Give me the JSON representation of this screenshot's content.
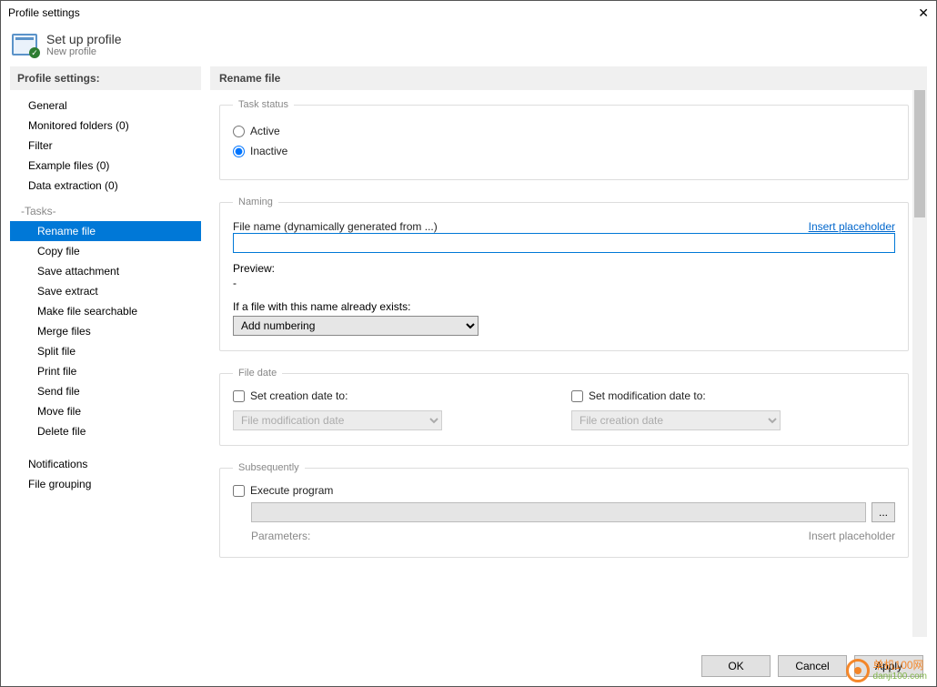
{
  "window": {
    "title": "Profile settings"
  },
  "header": {
    "title": "Set up profile",
    "subtitle": "New profile"
  },
  "sidebar": {
    "heading": "Profile settings:",
    "items": [
      {
        "label": "General",
        "indent": false
      },
      {
        "label": "Monitored folders (0)",
        "indent": false
      },
      {
        "label": "Filter",
        "indent": false
      },
      {
        "label": "Example files (0)",
        "indent": false
      },
      {
        "label": "Data extraction (0)",
        "indent": false
      },
      {
        "label": "-Tasks-",
        "separator": true
      },
      {
        "label": "Rename file",
        "indent": true,
        "selected": true
      },
      {
        "label": "Copy file",
        "indent": true
      },
      {
        "label": "Save attachment",
        "indent": true
      },
      {
        "label": "Save extract",
        "indent": true
      },
      {
        "label": "Make file searchable",
        "indent": true
      },
      {
        "label": "Merge files",
        "indent": true
      },
      {
        "label": "Split file",
        "indent": true
      },
      {
        "label": "Print file",
        "indent": true
      },
      {
        "label": "Send file",
        "indent": true
      },
      {
        "label": "Move file",
        "indent": true
      },
      {
        "label": "Delete file",
        "indent": true
      },
      {
        "label": "",
        "separator": true
      },
      {
        "label": "Notifications",
        "indent": false
      },
      {
        "label": "File grouping",
        "indent": false
      }
    ]
  },
  "content": {
    "heading": "Rename file",
    "task_status": {
      "legend": "Task status",
      "active_label": "Active",
      "inactive_label": "Inactive",
      "selected": "inactive"
    },
    "naming": {
      "legend": "Naming",
      "filename_label": "File name (dynamically generated from ...)",
      "insert_placeholder": "Insert placeholder",
      "filename_value": "",
      "preview_label": "Preview:",
      "preview_value": "-",
      "exists_label": "If a file with this name already exists:",
      "exists_value": "Add numbering"
    },
    "file_date": {
      "legend": "File date",
      "set_creation_label": "Set creation date to:",
      "creation_value": "File modification date",
      "set_modification_label": "Set modification date to:",
      "modification_value": "File creation date"
    },
    "subsequently": {
      "legend": "Subsequently",
      "execute_label": "Execute program",
      "browse": "...",
      "parameters_label": "Parameters:",
      "insert_placeholder": "Insert placeholder"
    }
  },
  "footer": {
    "ok": "OK",
    "cancel": "Cancel",
    "apply": "Apply"
  },
  "watermark": {
    "line1": "单机100网",
    "line2": "danji100.com"
  }
}
